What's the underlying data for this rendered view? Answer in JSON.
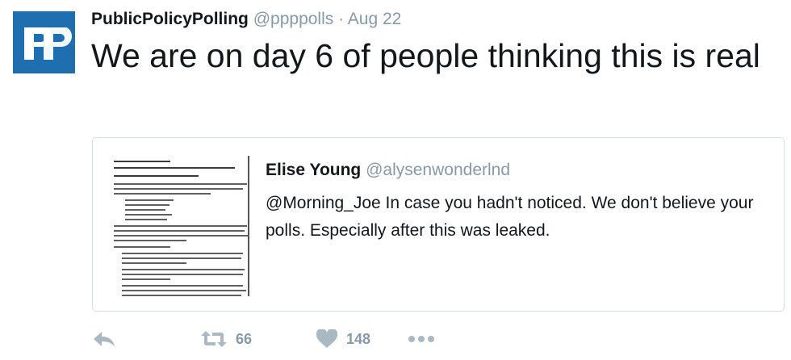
{
  "tweet": {
    "author_name": "PublicPolicyPolling",
    "author_handle": "@ppppolls",
    "separator": "·",
    "date": "Aug 22",
    "text": "We are on day 6 of people thinking this is real",
    "avatar_icon": "ppp-logo",
    "avatar_color": "#1f6fb0"
  },
  "quoted": {
    "author_name": "Elise Young",
    "author_handle": "@alysenwonderlnd",
    "text": "@Morning_Joe   In case you hadn't noticed. We don't believe your polls. Especially after this was leaked.",
    "image_icon": "document-thumbnail"
  },
  "actions": {
    "reply_icon": "reply-icon",
    "retweet_icon": "retweet-icon",
    "retweet_count": "66",
    "like_icon": "heart-icon",
    "like_count": "148",
    "more_icon": "more-icon"
  }
}
